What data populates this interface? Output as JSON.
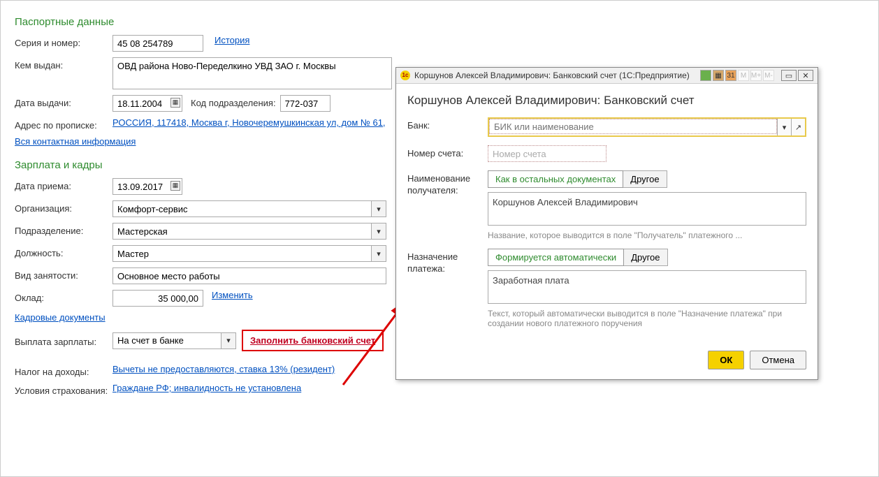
{
  "passport": {
    "title": "Паспортные данные",
    "serial_label": "Серия и номер:",
    "serial": "45 08 254789",
    "history": "История",
    "issued_by_label": "Кем выдан:",
    "issued_by": "ОВД района Ново-Переделкино УВД ЗАО г. Москвы",
    "issue_date_label": "Дата выдачи:",
    "issue_date": "18.11.2004",
    "dept_code_label": "Код подразделения:",
    "dept_code": "772-037",
    "address_label": "Адрес по прописке:",
    "address": "РОССИЯ, 117418, Москва г, Новочеремушкинская ул, дом № 61,",
    "all_contact": "Вся контактная информация"
  },
  "hr": {
    "title": "Зарплата и кадры",
    "hire_date_label": "Дата приема:",
    "hire_date": "13.09.2017",
    "org_label": "Организация:",
    "org": "Комфорт-сервис",
    "dept_label": "Подразделение:",
    "dept": "Мастерская",
    "position_label": "Должность:",
    "position": "Мастер",
    "employment_label": "Вид занятости:",
    "employment": "Основное место работы",
    "salary_label": "Оклад:",
    "salary": "35 000,00",
    "change": "Изменить",
    "hr_docs": "Кадровые документы",
    "payout_label": "Выплата зарплаты:",
    "payout": "На счет в банке",
    "fill_account": "Заполнить банковский счет",
    "tax_label": "Налог на доходы:",
    "tax": "Вычеты не предоставляются, ставка 13% (резидент)",
    "insurance_label": "Условия страхования:",
    "insurance": "Граждане РФ; инвалидность не установлена"
  },
  "dialog": {
    "titlebar": "Коршунов Алексей Владимирович: Банковский счет  (1С:Предприятие)",
    "heading": "Коршунов Алексей Владимирович: Банковский счет",
    "bank_label": "Банк:",
    "bank_placeholder": "БИК или наименование",
    "account_label": "Номер счета:",
    "account_placeholder": "Номер счета",
    "recipient_label": "Наименование получателя:",
    "as_other_docs": "Как в остальных документах",
    "other": "Другое",
    "recipient_value": "Коршунов Алексей Владимирович",
    "recipient_hint": "Название, которое выводится в поле \"Получатель\" платежного ...",
    "purpose_label": "Назначение платежа:",
    "auto_form": "Формируется автоматически",
    "purpose_value": "Заработная плата",
    "purpose_hint": "Текст, который автоматически выводится в поле \"Назначение платежа\" при создании нового платежного поручения",
    "ok": "ОК",
    "cancel": "Отмена"
  }
}
